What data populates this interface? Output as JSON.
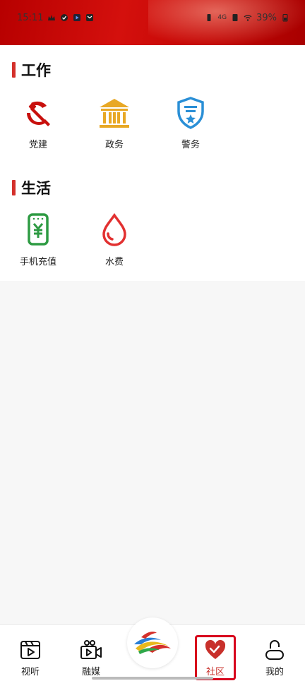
{
  "status_bar": {
    "time": "15:11",
    "battery": "39%",
    "network": "4G"
  },
  "sections": [
    {
      "title": "工作",
      "items": [
        {
          "label": "党建",
          "icon": "party-emblem-icon"
        },
        {
          "label": "政务",
          "icon": "government-building-icon"
        },
        {
          "label": "警务",
          "icon": "police-shield-icon"
        }
      ]
    },
    {
      "title": "生活",
      "items": [
        {
          "label": "手机充值",
          "icon": "phone-recharge-icon"
        },
        {
          "label": "水费",
          "icon": "water-drop-icon"
        }
      ]
    }
  ],
  "tabs": [
    {
      "label": "视听",
      "icon": "video-play-icon",
      "active": false
    },
    {
      "label": "融媒",
      "icon": "camera-icon",
      "active": false
    },
    {
      "label": "",
      "icon": "center-logo-icon",
      "active": false
    },
    {
      "label": "社区",
      "icon": "heart-community-icon",
      "active": true
    },
    {
      "label": "我的",
      "icon": "profile-icon",
      "active": false
    }
  ],
  "colors": {
    "header": "#c8100d",
    "accent": "#d4302b",
    "gov": "#e8a825",
    "police": "#2a8fd6",
    "recharge": "#2e9b43",
    "water": "#e23030"
  }
}
